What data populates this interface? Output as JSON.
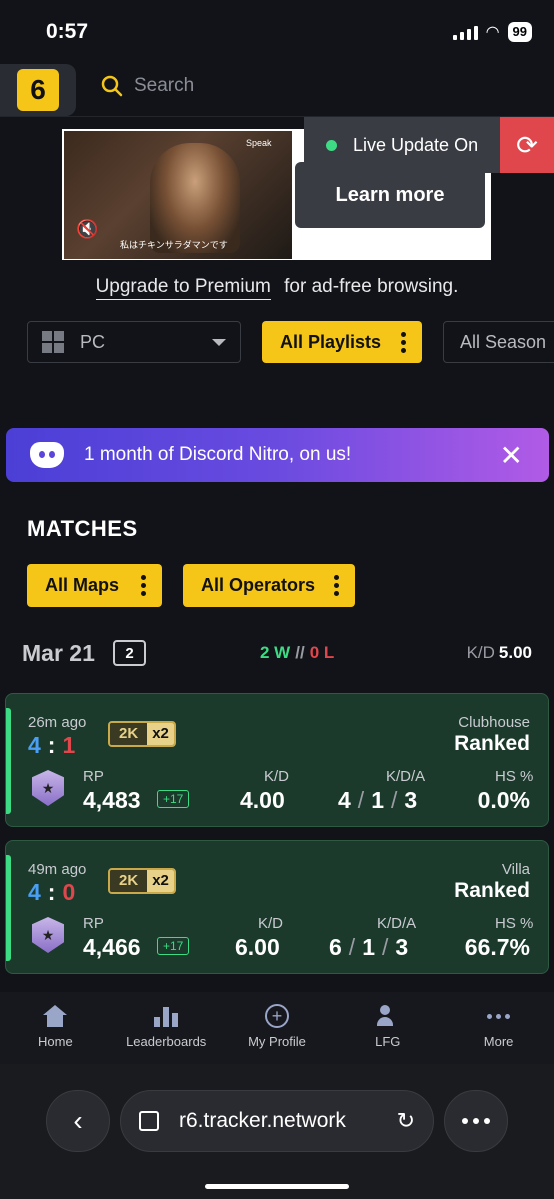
{
  "status_bar": {
    "time": "0:57",
    "battery": "99"
  },
  "header": {
    "logo_letter": "6",
    "search_placeholder": "Search"
  },
  "ad": {
    "brand": "Speak",
    "caption": "私はチキンサラダマンです",
    "live_update": "Live Update On",
    "learn_more": "Learn more"
  },
  "premium": {
    "link": "Upgrade to Premium",
    "text": "for ad-free browsing."
  },
  "filters": {
    "platform": "PC",
    "playlists": "All Playlists",
    "season": "All Season"
  },
  "discord_banner": {
    "text": "1 month of Discord Nitro, on us!"
  },
  "matches": {
    "title": "MATCHES",
    "maps_filter": "All Maps",
    "operators_filter": "All Operators",
    "day": {
      "date": "Mar 21",
      "count": "2",
      "wins": "2 W",
      "sep": "//",
      "losses": "0 L",
      "kd_label": "K/D",
      "kd_value": "5.00"
    },
    "items": [
      {
        "time": "26m ago",
        "score_a": "4",
        "score_b": "1",
        "badge_k": "2K",
        "badge_x": "x2",
        "map": "Clubhouse",
        "mode": "Ranked",
        "rp_label": "RP",
        "rp": "4,483",
        "rp_delta": "+17",
        "kd_label": "K/D",
        "kd": "4.00",
        "kda_label": "K/D/A",
        "k": "4",
        "d": "1",
        "a": "3",
        "hs_label": "HS %",
        "hs": "0.0%"
      },
      {
        "time": "49m ago",
        "score_a": "4",
        "score_b": "0",
        "badge_k": "2K",
        "badge_x": "x2",
        "map": "Villa",
        "mode": "Ranked",
        "rp_label": "RP",
        "rp": "4,466",
        "rp_delta": "+17",
        "kd_label": "K/D",
        "kd": "6.00",
        "kda_label": "K/D/A",
        "k": "6",
        "d": "1",
        "a": "3",
        "hs_label": "HS %",
        "hs": "66.7%"
      }
    ]
  },
  "bottom_nav": [
    "Home",
    "Leaderboards",
    "My Profile",
    "LFG",
    "More"
  ],
  "browser": {
    "url": "r6.tracker.network"
  },
  "colors": {
    "accent": "#f5c518",
    "win": "#3ddc84",
    "loss": "#e0474c",
    "blue": "#4a9ff5"
  }
}
